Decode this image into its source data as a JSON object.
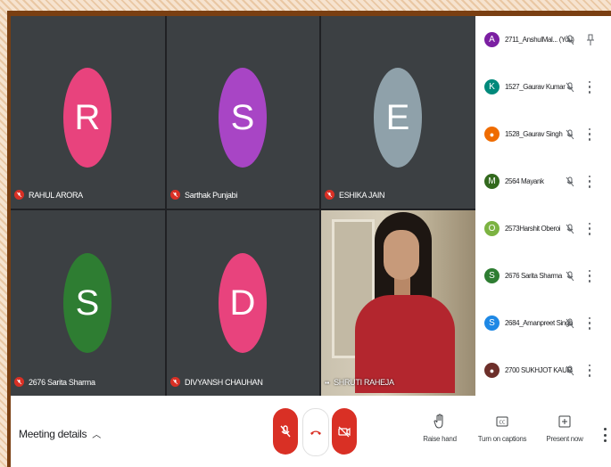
{
  "tiles": [
    {
      "initial": "R",
      "name": "RAHUL ARORA",
      "color": "#e8437d"
    },
    {
      "initial": "S",
      "name": "Sarthak Punjabi",
      "color": "#a845c5"
    },
    {
      "initial": "E",
      "name": "ESHIKA JAIN",
      "color": "#8fa1aa"
    },
    {
      "initial": "S",
      "name": "2676 Sarita Sharma",
      "color": "#2e7d32"
    },
    {
      "initial": "D",
      "name": "DIVYANSH CHAUHAN",
      "color": "#e8437d"
    },
    {
      "initial": "",
      "name": "SHRUTI RAHEJA",
      "color": "#000000"
    }
  ],
  "participants": [
    {
      "initial": "A",
      "name": "2711_AnshulMal...  (You)",
      "color": "#7b1fa2"
    },
    {
      "initial": "K",
      "name": "1527_Gaurav Kumar",
      "color": "#00897b"
    },
    {
      "initial": "",
      "name": "1528_Gaurav Singh",
      "color": "#ef6c00"
    },
    {
      "initial": "M",
      "name": "2564 Mayank",
      "color": "#33691e"
    },
    {
      "initial": "O",
      "name": "2573Harshit Oberoi",
      "color": "#7cb342"
    },
    {
      "initial": "S",
      "name": "2676 Sarita Sharma",
      "color": "#2e7d32"
    },
    {
      "initial": "S",
      "name": "2684_Amanpreet Singh",
      "color": "#1e88e5"
    },
    {
      "initial": "",
      "name": "2700 SUKHJOT KAUR",
      "color": "#6d2f2a"
    }
  ],
  "bottom": {
    "meeting_details": "Meeting details",
    "raise_hand": "Raise hand",
    "captions": "Turn on captions",
    "present": "Present now"
  },
  "colors": {
    "danger": "#d93025",
    "panel": "#ffffff",
    "dark": "#202124"
  },
  "icons": [
    "mic-off-icon",
    "end-call-icon",
    "camera-off-icon",
    "hand-icon",
    "captions-icon",
    "present-icon",
    "pin-icon",
    "more-icon"
  ]
}
